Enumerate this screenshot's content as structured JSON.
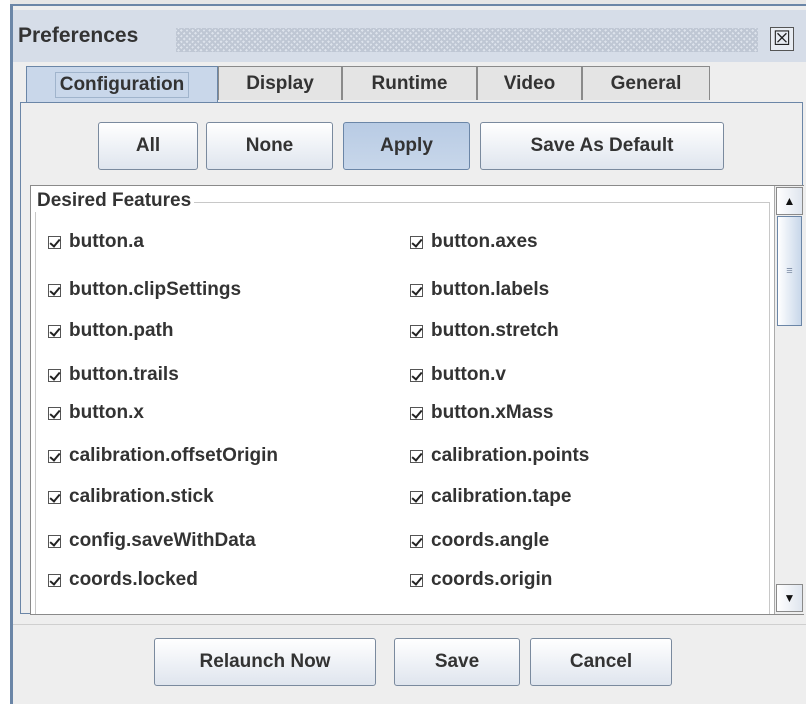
{
  "window": {
    "title": "Preferences",
    "close_glyph": "☒"
  },
  "tabs": [
    {
      "label": "Configuration",
      "active": true
    },
    {
      "label": "Display",
      "active": false
    },
    {
      "label": "Runtime",
      "active": false
    },
    {
      "label": "Video",
      "active": false
    },
    {
      "label": "General",
      "active": false
    }
  ],
  "toolbar": {
    "all_label": "All",
    "none_label": "None",
    "apply_label": "Apply",
    "save_default_label": "Save As Default"
  },
  "features": {
    "group_title": "Desired Features",
    "items": [
      {
        "label": "button.a",
        "checked": true
      },
      {
        "label": "button.axes",
        "checked": true
      },
      {
        "label": "button.clipSettings",
        "checked": true
      },
      {
        "label": "button.labels",
        "checked": true
      },
      {
        "label": "button.path",
        "checked": true
      },
      {
        "label": "button.stretch",
        "checked": true
      },
      {
        "label": "button.trails",
        "checked": true
      },
      {
        "label": "button.v",
        "checked": true
      },
      {
        "label": "button.x",
        "checked": true
      },
      {
        "label": "button.xMass",
        "checked": true
      },
      {
        "label": "calibration.offsetOrigin",
        "checked": true
      },
      {
        "label": "calibration.points",
        "checked": true
      },
      {
        "label": "calibration.stick",
        "checked": true
      },
      {
        "label": "calibration.tape",
        "checked": true
      },
      {
        "label": "config.saveWithData",
        "checked": true
      },
      {
        "label": "coords.angle",
        "checked": true
      },
      {
        "label": "coords.locked",
        "checked": true
      },
      {
        "label": "coords.origin",
        "checked": true
      }
    ]
  },
  "scrollbar": {
    "up_glyph": "▲",
    "down_glyph": "▼",
    "grip_glyph": "≡"
  },
  "footer": {
    "relaunch_label": "Relaunch Now",
    "save_label": "Save",
    "cancel_label": "Cancel"
  },
  "colors": {
    "accent": "#6b86a7",
    "tab_active": "#c9d7ea",
    "pressed_button": "#b8cbe4"
  }
}
